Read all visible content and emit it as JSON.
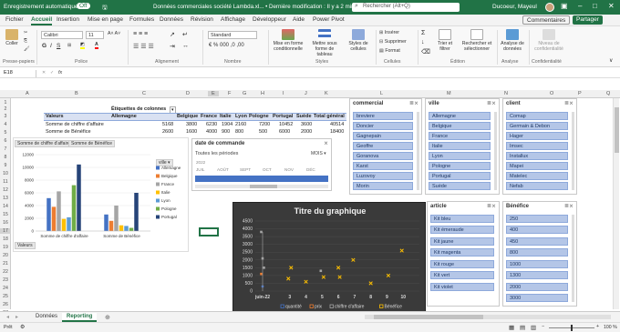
{
  "titlebar": {
    "autosave": "Enregistrement automatique",
    "autosave_state": "Off",
    "document": "Données commerciales société Lambda.xl... • Dernière modification : Il y a 2 min",
    "search_placeholder": "Rechercher (Alt+Q)",
    "user": "Ducoeur, Mayeul"
  },
  "tabs": [
    "Fichier",
    "Accueil",
    "Insertion",
    "Mise en page",
    "Formules",
    "Données",
    "Révision",
    "Affichage",
    "Développeur",
    "Aide",
    "Power Pivot"
  ],
  "actions": {
    "comments": "Commentaires",
    "share": "Partager"
  },
  "ribbon": {
    "groups": [
      "Presse-papiers",
      "Police",
      "Alignement",
      "Nombre",
      "Styles",
      "Cellules",
      "Édition",
      "Analyse",
      "Confidentialité"
    ],
    "paste": "Coller",
    "font": "Calibri",
    "size": "11",
    "number_format": "Standard",
    "cond_format": "Mise en forme conditionnelle",
    "table_format": "Mettre sous forme de tableau",
    "cell_styles": "Styles de cellules",
    "insert": "Insérer",
    "delete": "Supprimer",
    "format": "Format",
    "sort": "Trier et filtrer",
    "find": "Rechercher et sélectionner",
    "analyze": "Analyse de données",
    "sensitivity": "Niveau de confidentialité"
  },
  "formula_bar": {
    "name_box": "E18",
    "formula": ""
  },
  "columns": [
    "A",
    "B",
    "C",
    "D",
    "E",
    "F",
    "G",
    "H",
    "I",
    "J",
    "K",
    "L",
    "M",
    "N",
    "O",
    "P",
    "Q"
  ],
  "rows": [
    "1",
    "2",
    "3",
    "4",
    "5",
    "6",
    "7",
    "8",
    "9",
    "10",
    "11",
    "12",
    "13",
    "14",
    "15",
    "16",
    "17",
    "18",
    "19",
    "20",
    "21",
    "22",
    "23",
    "24",
    "25",
    "26",
    "27",
    "28"
  ],
  "pivot": {
    "col_label": "Étiquettes de colonnes",
    "values_label": "Valeurs",
    "headers": [
      "Allemagne",
      "Belgique",
      "France",
      "Italie",
      "Lyon",
      "Pologne",
      "Portugal",
      "Suède",
      "Total général"
    ],
    "rows": [
      {
        "label": "Somme de chiffre d'affaire",
        "values": [
          "5168",
          "3800",
          "6230",
          "1904",
          "2160",
          "7200",
          "10452",
          "3600",
          "40514"
        ]
      },
      {
        "label": "Somme de Bénéfice",
        "values": [
          "2600",
          "1600",
          "4000",
          "900",
          "800",
          "500",
          "6000",
          "2000",
          "18400"
        ]
      }
    ]
  },
  "pivot_chart": {
    "field_buttons": [
      "Somme de chiffre d'affaire",
      "Somme de Bénéfice",
      "Valeurs",
      "ville"
    ],
    "legend": [
      "Allemagne",
      "Belgique",
      "France",
      "Italie",
      "Lyon",
      "Pologne",
      "Portugal"
    ],
    "colors": {
      "Allemagne": "#4472c4",
      "Belgique": "#ed7d31",
      "France": "#a5a5a5",
      "Italie": "#ffc000",
      "Lyon": "#5b9bd5",
      "Pologne": "#70ad47",
      "Portugal": "#264478"
    }
  },
  "chart_data": [
    {
      "type": "bar",
      "categories": [
        "Somme de chiffre d'affaire",
        "Somme de Bénéfice"
      ],
      "yticks": [
        "0",
        "2000",
        "4000",
        "6000",
        "8000",
        "10000",
        "12000"
      ],
      "ylim": [
        0,
        12000
      ],
      "series": [
        {
          "name": "Allemagne",
          "values": [
            5168,
            2600
          ]
        },
        {
          "name": "Belgique",
          "values": [
            3800,
            1600
          ]
        },
        {
          "name": "France",
          "values": [
            6230,
            4000
          ]
        },
        {
          "name": "Italie",
          "values": [
            1904,
            900
          ]
        },
        {
          "name": "Lyon",
          "values": [
            2160,
            800
          ]
        },
        {
          "name": "Pologne",
          "values": [
            7200,
            500
          ]
        },
        {
          "name": "Portugal",
          "values": [
            10452,
            6000
          ]
        }
      ]
    },
    {
      "type": "scatter",
      "title": "Titre du graphique",
      "yticks": [
        "0",
        "500",
        "1000",
        "1500",
        "2000",
        "2500",
        "3000",
        "3500",
        "4000",
        "4500"
      ],
      "ylim": [
        0,
        4500
      ],
      "xticks": [
        "juin-22",
        "3",
        "4",
        "5",
        "6",
        "7",
        "8",
        "9",
        "10"
      ],
      "legend": [
        "quantité",
        "prix",
        "chiffre d'affaire",
        "Bénéfice"
      ],
      "colors": {
        "quantité": "#4472c4",
        "prix": "#ed7d31",
        "chiffre d'affaire": "#a5a5a5",
        "Bénéfice": "#ffc000"
      },
      "points": [
        {
          "x": "juin-22",
          "y": 3800,
          "s": "chiffre d'affaire"
        },
        {
          "x": "juin-22",
          "y": 2100,
          "s": "chiffre d'affaire"
        },
        {
          "x": "juin-22",
          "y": 1500,
          "s": "chiffre d'affaire"
        },
        {
          "x": "juin-22",
          "y": 1100,
          "s": "prix"
        },
        {
          "x": "juin-22",
          "y": 300,
          "s": "quantité"
        },
        {
          "x": "3",
          "y": 1500,
          "s": "Bénéfice"
        },
        {
          "x": "3",
          "y": 800,
          "s": "Bénéfice"
        },
        {
          "x": "4",
          "y": 600,
          "s": "Bénéfice"
        },
        {
          "x": "5",
          "y": 900,
          "s": "Bénéfice"
        },
        {
          "x": "5",
          "y": 1300,
          "s": "chiffre d'affaire"
        },
        {
          "x": "6",
          "y": 1500,
          "s": "Bénéfice"
        },
        {
          "x": "6",
          "y": 900,
          "s": "Bénéfice"
        },
        {
          "x": "7",
          "y": 2000,
          "s": "Bénéfice"
        },
        {
          "x": "8",
          "y": 500,
          "s": "Bénéfice"
        },
        {
          "x": "9",
          "y": 1000,
          "s": "Bénéfice"
        },
        {
          "x": "10",
          "y": 2600,
          "s": "Bénéfice"
        }
      ]
    }
  ],
  "timeline": {
    "title": "date de commande",
    "all": "Toutes les périodes",
    "unit": "MOIS",
    "year": "2022",
    "months": [
      "JUIL",
      "AOÛT",
      "SEPT",
      "OCT",
      "NOV",
      "DÉC"
    ]
  },
  "slicers": {
    "commercial": {
      "title": "commercial",
      "items": [
        "breviere",
        "Doncier",
        "Gagnepain",
        "Geoffre",
        "Goranova",
        "Karst",
        "Luzovoy",
        "Morin"
      ]
    },
    "ville": {
      "title": "ville",
      "items": [
        "Allemagne",
        "Belgique",
        "France",
        "Italie",
        "Lyon",
        "Pologne",
        "Portugal",
        "Suède"
      ]
    },
    "client": {
      "title": "client",
      "items": [
        "Comap",
        "Germain & Debon",
        "Hager",
        "Imsec",
        "Installux",
        "Mapei",
        "Matelec",
        "Nefab"
      ]
    },
    "article": {
      "title": "article",
      "items": [
        "Kit bleu",
        "Kit émeraude",
        "Kit jaune",
        "Kit magenta",
        "Kit rouge",
        "Kit vert",
        "Kit violet"
      ]
    },
    "benefice": {
      "title": "Bénéfice",
      "items": [
        "250",
        "400",
        "450",
        "800",
        "1000",
        "1300",
        "2000",
        "3000"
      ]
    }
  },
  "sheets": [
    "Données",
    "Reporting"
  ],
  "status": {
    "ready": "Prêt",
    "zoom": "100 %"
  }
}
